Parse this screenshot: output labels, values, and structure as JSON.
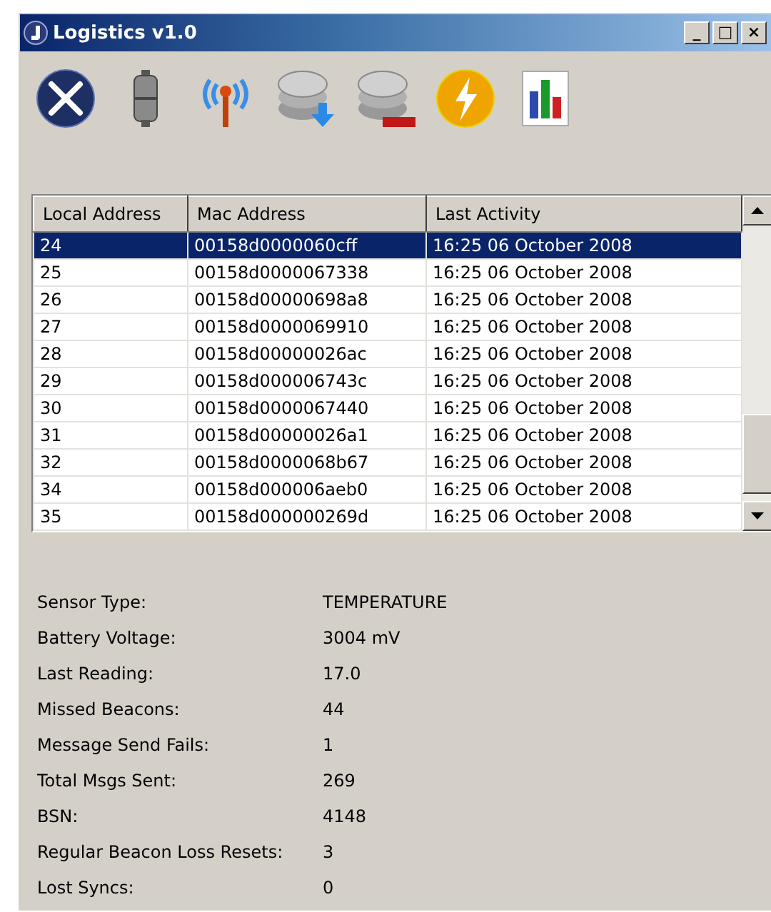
{
  "window": {
    "title": "Logistics v1.0",
    "controls": [
      "_",
      "□",
      "×"
    ]
  },
  "table": {
    "columns": [
      "Local Address",
      "Mac Address",
      "Last Activity"
    ],
    "rows": [
      {
        "cells": [
          "24",
          "00158d0000060cff",
          "16:25 06 October 2008"
        ],
        "selected": true
      },
      {
        "cells": [
          "25",
          "00158d0000067338",
          "16:25 06 October 2008"
        ],
        "selected": false
      },
      {
        "cells": [
          "26",
          "00158d00000698a8",
          "16:25 06 October 2008"
        ],
        "selected": false
      },
      {
        "cells": [
          "27",
          "00158d0000069910",
          "16:25 06 October 2008"
        ],
        "selected": false
      },
      {
        "cells": [
          "28",
          "00158d00000026ac",
          "16:25 06 October 2008"
        ],
        "selected": false
      },
      {
        "cells": [
          "29",
          "00158d000006743c",
          "16:25 06 October 2008"
        ],
        "selected": false
      },
      {
        "cells": [
          "30",
          "00158d0000067440",
          "16:25 06 October 2008"
        ],
        "selected": false
      },
      {
        "cells": [
          "31",
          "00158d00000026a1",
          "16:25 06 October 2008"
        ],
        "selected": false
      },
      {
        "cells": [
          "32",
          "00158d0000068b67",
          "16:25 06 October 2008"
        ],
        "selected": false
      },
      {
        "cells": [
          "34",
          "00158d000006aeb0",
          "16:25 06 October 2008"
        ],
        "selected": false
      },
      {
        "cells": [
          "35",
          "00158d000000269d",
          "16:25 06 October 2008"
        ],
        "selected": false
      }
    ]
  },
  "details": [
    {
      "label": "Sensor Type:",
      "value": "TEMPERATURE"
    },
    {
      "label": "Battery Voltage:",
      "value": "3004 mV"
    },
    {
      "label": "Last Reading:",
      "value": "17.0"
    },
    {
      "label": "Missed Beacons:",
      "value": "44"
    },
    {
      "label": "Message Send Fails:",
      "value": "1"
    },
    {
      "label": "Total Msgs Sent:",
      "value": "269"
    },
    {
      "label": "BSN:",
      "value": "4148"
    },
    {
      "label": "Regular Beacon Loss Resets:",
      "value": "3"
    },
    {
      "label": "Lost Syncs:",
      "value": "0"
    }
  ]
}
